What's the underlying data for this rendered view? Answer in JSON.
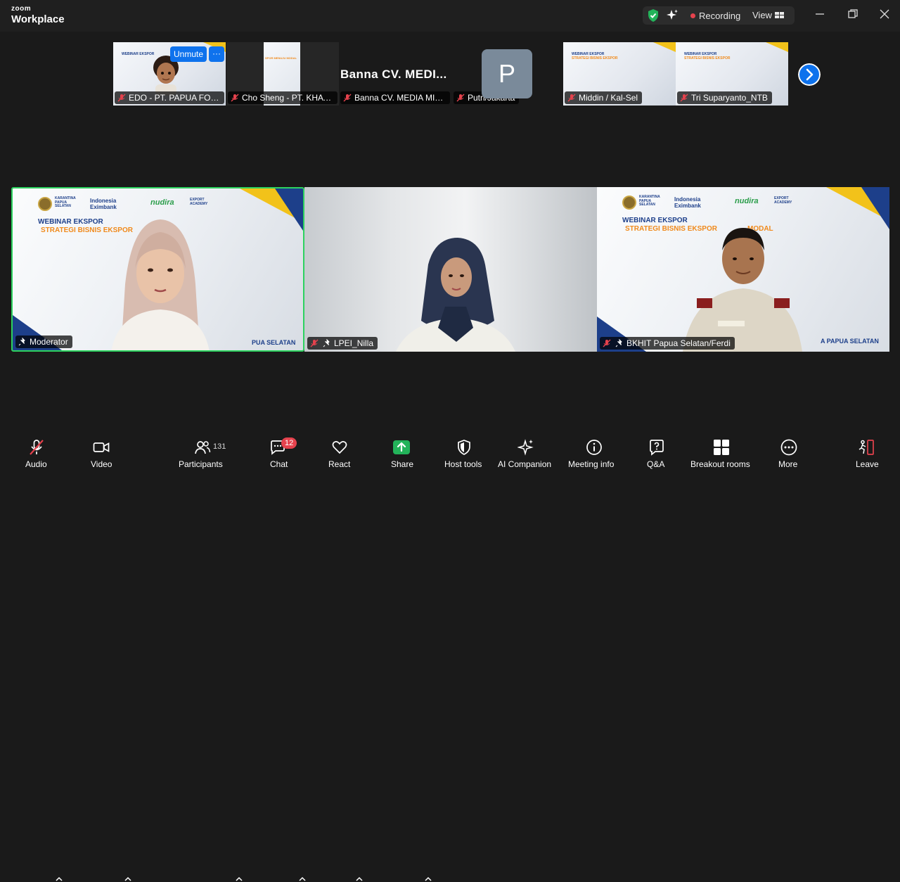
{
  "app": {
    "brand_small": "zoom",
    "brand_large": "Workplace"
  },
  "topbar": {
    "recording_label": "Recording",
    "view_label": "View"
  },
  "unmute_label": "Unmute",
  "more_label": "···",
  "banna_display": "Banna  CV.  MEDI...",
  "p_avatar_letter": "P",
  "thumbs": [
    {
      "name": "EDO - PT. PAPUA FOR..."
    },
    {
      "name": "Cho Sheng - PT. KHAT..."
    },
    {
      "name": "Banna CV. MEDIA MIT..."
    },
    {
      "name": "Putri/Jakarta"
    },
    {
      "name": "Middin / Kal-Sel"
    },
    {
      "name": "Tri Suparyanto_NTB"
    }
  ],
  "tiles": [
    {
      "name": "Moderator",
      "webinar_title": "WEBINAR EKSPOR",
      "webinar_subtitle": "STRATEGI BISNIS EKSPOR",
      "footer": "PUA SELATAN",
      "logos": {
        "karantina": "KARANTINA\nPAPUA\nSELATAN",
        "eximbank": "Indonesia\nEximbank",
        "nudira": "nudira",
        "academy": "EXPORT\nACADEMY"
      }
    },
    {
      "name": "LPEI_Nilla"
    },
    {
      "name": "BKHIT Papua Selatan/Ferdi",
      "webinar_title": "WEBINAR EKSPOR",
      "webinar_subtitle": "STRATEGI BISNIS EKSPOR",
      "webinar_subtitle_end": "MODAL",
      "footer": "A PAPUA SELATAN",
      "logos": {
        "karantina": "KARANTINA\nPAPUA\nSELATAN",
        "eximbank": "Indonesia\nEximbank",
        "nudira": "nudira",
        "academy": "EXPORT\nACADEMY"
      }
    }
  ],
  "toolbar": {
    "audio": "Audio",
    "video": "Video",
    "participants": "Participants",
    "participants_count": "131",
    "chat": "Chat",
    "chat_badge": "12",
    "react": "React",
    "share": "Share",
    "host_tools": "Host tools",
    "ai_companion": "AI Companion",
    "meeting_info": "Meeting info",
    "qa": "Q&A",
    "breakout_rooms": "Breakout rooms",
    "more": "More",
    "leave": "Leave"
  },
  "colors": {
    "accent": "#0e72ed",
    "active_speaker": "#2dd25f",
    "recording": "#e5424d",
    "share": "#23b35a",
    "leave": "#e5424d"
  }
}
